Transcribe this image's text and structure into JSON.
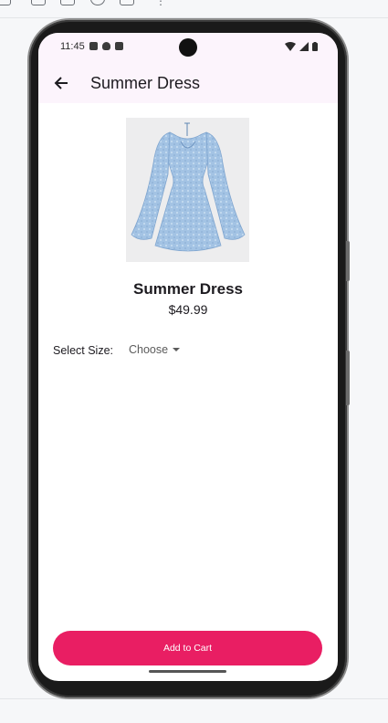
{
  "status_bar": {
    "time": "11:45"
  },
  "app_bar": {
    "title": "Summer Dress"
  },
  "product": {
    "name": "Summer Dress",
    "price": "$49.99",
    "image_color": "#9fc1e3"
  },
  "size_selector": {
    "label": "Select Size:",
    "selected": "Choose"
  },
  "actions": {
    "add_to_cart": "Add to Cart"
  },
  "colors": {
    "accent": "#e91e63",
    "app_bar_bg": "#fcf4fc"
  }
}
